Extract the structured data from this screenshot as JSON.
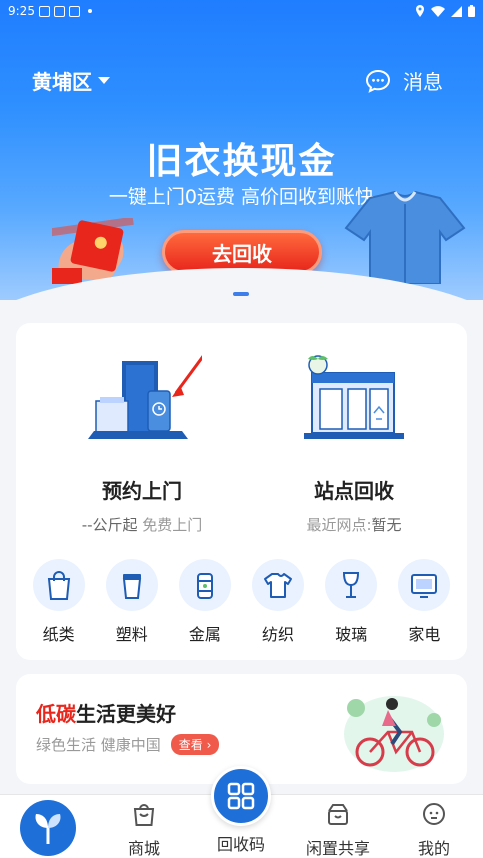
{
  "status": {
    "time": "9:25"
  },
  "header": {
    "location": "黄埔区",
    "message_label": "消息"
  },
  "hero": {
    "title": "旧衣换现金",
    "subtitle": "一键上门0运费  高价回收到账快",
    "button": "去回收"
  },
  "services": {
    "booking": {
      "title": "预约上门",
      "sub_prefix": "--公斤起",
      "sub_suffix": " 免费上门"
    },
    "station": {
      "title": "站点回收",
      "sub_prefix": "最近网点:",
      "sub_suffix": "暂无"
    }
  },
  "categories": [
    {
      "label": "纸类",
      "icon": "paper-bag-icon"
    },
    {
      "label": "塑料",
      "icon": "plastic-cup-icon"
    },
    {
      "label": "金属",
      "icon": "metal-can-icon"
    },
    {
      "label": "纺织",
      "icon": "tshirt-icon"
    },
    {
      "label": "玻璃",
      "icon": "wine-glass-icon"
    },
    {
      "label": "家电",
      "icon": "appliance-icon"
    }
  ],
  "banner": {
    "title_red": "低碳",
    "title_rest": "生活更美好",
    "subtitle": "绿色生活 健康中国",
    "button": "查看 ›"
  },
  "nav": {
    "mall": "商城",
    "recycle_code": "回收码",
    "idle_share": "闲置共享",
    "mine": "我的"
  },
  "colors": {
    "primary": "#1e6fd8",
    "accent_red": "#e8261c"
  }
}
